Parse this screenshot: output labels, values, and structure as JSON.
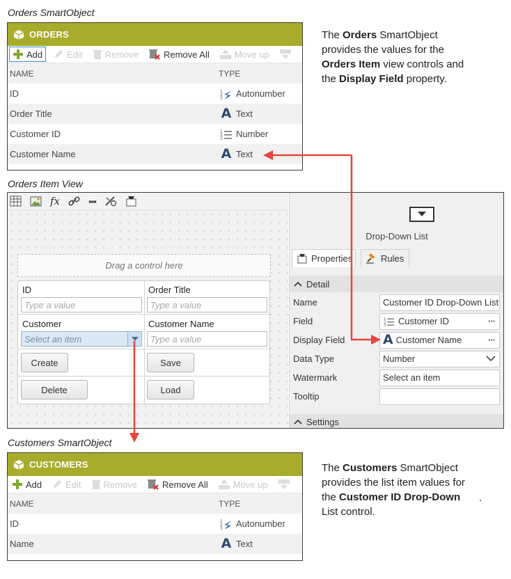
{
  "orders_section": {
    "title": "Orders SmartObject",
    "header": "ORDERS",
    "toolbar": {
      "add": "Add",
      "edit": "Edit",
      "remove": "Remove",
      "remove_all": "Remove All",
      "move_up": "Move up"
    },
    "columns": {
      "name": "NAME",
      "type": "TYPE"
    },
    "rows": [
      {
        "name": "ID",
        "type": "Autonumber",
        "type_icon": "autonumber-icon"
      },
      {
        "name": "Order Title",
        "type": "Text",
        "type_icon": "text-type-icon"
      },
      {
        "name": "Customer ID",
        "type": "Number",
        "type_icon": "number-icon"
      },
      {
        "name": "Customer Name",
        "type": "Text",
        "type_icon": "text-type-icon"
      }
    ]
  },
  "orders_description": {
    "p1": "The ",
    "b1": "Orders",
    "p2": " SmartObject provides the values for the ",
    "b2": "Orders Item",
    "p3": " view controls and the ",
    "b3": "Display Field",
    "p4": " property."
  },
  "view_section": {
    "title": "Orders Item View",
    "drag_hint": "Drag a control here",
    "fields": {
      "id_label": "ID",
      "id_placeholder": "Type a value",
      "order_title_label": "Order Title",
      "order_title_placeholder": "Type a value",
      "customer_label": "Customer",
      "customer_placeholder": "Select an item",
      "customer_name_label": "Customer Name",
      "customer_name_placeholder": "Type a value"
    },
    "buttons": {
      "create": "Create",
      "save": "Save",
      "delete": "Delete",
      "load": "Load"
    }
  },
  "properties": {
    "control_type": "Drop-Down List",
    "tabs": {
      "properties": "Properties",
      "rules": "Rules"
    },
    "detail_section": "Detail",
    "settings_section": "Settings",
    "rows": {
      "name_label": "Name",
      "name_value": "Customer ID Drop-Down List",
      "field_label": "Field",
      "field_value": "Customer ID",
      "display_label": "Display Field",
      "display_value": "Customer Name",
      "datatype_label": "Data Type",
      "datatype_value": "Number",
      "watermark_label": "Watermark",
      "watermark_value": "Select an item",
      "tooltip_label": "Tooltip",
      "tooltip_value": ""
    }
  },
  "customers_section": {
    "title": "Customers SmartObject",
    "header": "CUSTOMERS",
    "toolbar": {
      "add": "Add",
      "edit": "Edit",
      "remove": "Remove",
      "remove_all": "Remove All",
      "move_up": "Move up"
    },
    "columns": {
      "name": "NAME",
      "type": "TYPE"
    },
    "rows": [
      {
        "name": "ID",
        "type": "Autonumber",
        "type_icon": "autonumber-icon"
      },
      {
        "name": "Name",
        "type": "Text",
        "type_icon": "text-type-icon"
      }
    ]
  },
  "customers_description": {
    "p1": "The ",
    "b1": "Customers",
    "p2": " SmartObject provides the list item values for the ",
    "b2": "Customer ID Drop-Down",
    "p3": " List control.",
    "stray": "."
  },
  "colors": {
    "header_olive": "#a7ac2b",
    "arrow_red": "#e8453c",
    "text_icon_blue": "#2b4a6f"
  }
}
